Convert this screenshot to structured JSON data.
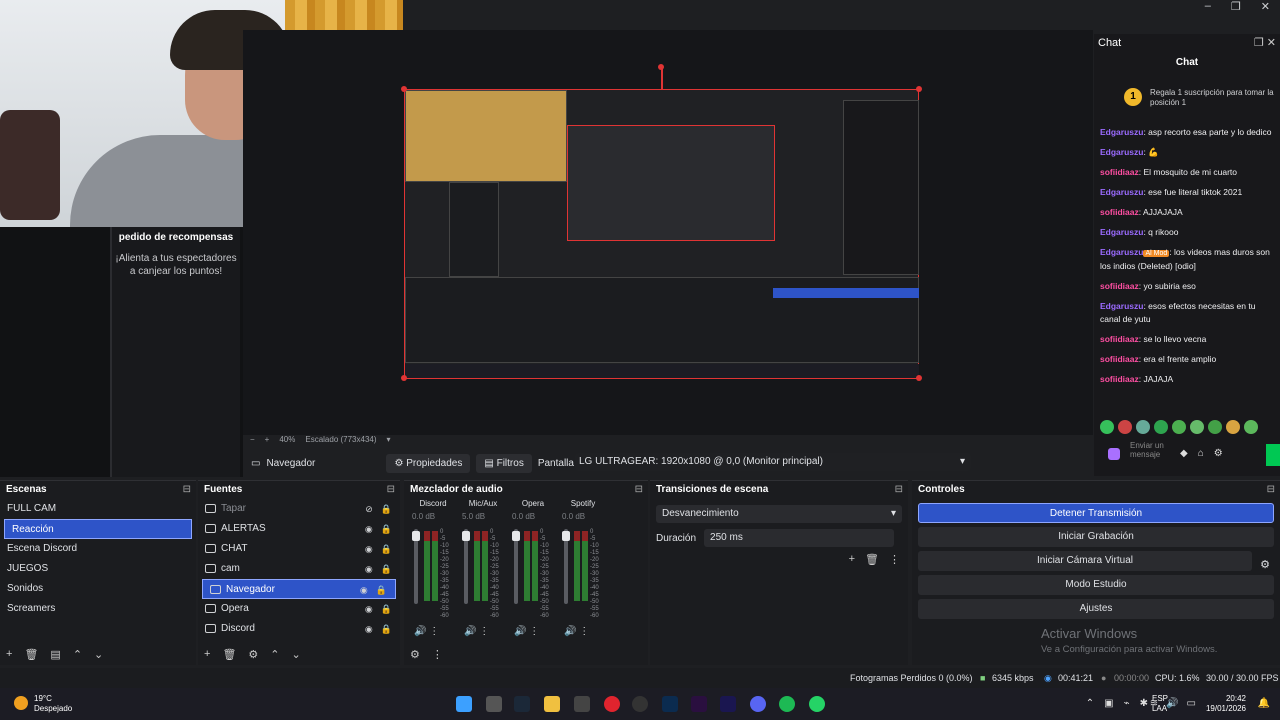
{
  "window": {
    "controls": [
      "–",
      "❐",
      "✕"
    ]
  },
  "rewards": {
    "title": "pedido de recompensas",
    "subtitle": "¡Alienta a tus espectadores a canjear los puntos!"
  },
  "preview": {
    "zoom": "40%",
    "scaling": "Escalado (773x434)"
  },
  "chat": {
    "dock_title": "Chat",
    "header": "Chat",
    "sub_badge": "1",
    "sub_text": "Regala 1 suscripción para tomar la posición 1",
    "messages": [
      {
        "user": "Edgaruszu",
        "text": ": asp recorto esa parte y lo dedico",
        "color": "u1"
      },
      {
        "user": "Edgaruszu",
        "text": ": 💪",
        "color": "u1"
      },
      {
        "user": "sofiidiaaz",
        "text": ": El mosquito de mi cuarto",
        "color": "u2"
      },
      {
        "user": "Edgaruszu",
        "text": ": ese fue literal tiktok 2021",
        "color": "u1"
      },
      {
        "user": "sofiidiaaz",
        "text": ": AJJAJAJA",
        "color": "u2"
      },
      {
        "user": "Edgaruszu",
        "text": ": q rikooo",
        "color": "u1"
      },
      {
        "user": "Edgaruszu",
        "text": ": los videos mas duros son los indios (Deleted) [odio]",
        "color": "u1",
        "badge": "Al Mod"
      },
      {
        "user": "sofiidiaaz",
        "text": ": yo subiria eso",
        "color": "u2"
      },
      {
        "user": "Edgaruszu",
        "text": ": esos efectos necesitas en tu canal de yutu",
        "color": "u1"
      },
      {
        "user": "sofiidiaaz",
        "text": ": se lo llevo vecna",
        "color": "u2"
      },
      {
        "user": "sofiidiaaz",
        "text": ": era el frente amplio",
        "color": "u2"
      },
      {
        "user": "sofiidiaaz",
        "text": ": JAJAJA",
        "color": "u2"
      }
    ],
    "input_placeholder": "Enviar un mensaje"
  },
  "toolbar": {
    "source_name": "Navegador",
    "properties": "Propiedades",
    "filters": "Filtros",
    "screen_label": "Pantalla",
    "monitor": "LG ULTRAGEAR: 1920x1080 @ 0,0 (Monitor principal)"
  },
  "scenes": {
    "title": "Escenas",
    "items": [
      "FULL CAM",
      "Reacción",
      "Escena Discord",
      "JUEGOS",
      "Sonidos",
      "Screamers"
    ],
    "selected": 1
  },
  "sources": {
    "title": "Fuentes",
    "items": [
      "Tapar",
      "ALERTAS",
      "CHAT",
      "cam",
      "Navegador",
      "Opera",
      "Discord"
    ],
    "selected": 4
  },
  "mixer": {
    "title": "Mezclador de audio",
    "channels": [
      {
        "name": "Discord",
        "db": "0.0 dB"
      },
      {
        "name": "Mic/Aux",
        "db": "5.0 dB"
      },
      {
        "name": "Opera",
        "db": "0.0 dB"
      },
      {
        "name": "Spotify",
        "db": "0.0 dB"
      }
    ],
    "scale": [
      "0",
      "-5",
      "-10",
      "-15",
      "-20",
      "-25",
      "-30",
      "-35",
      "-40",
      "-45",
      "-50",
      "-55",
      "-60"
    ]
  },
  "transitions": {
    "title": "Transiciones de escena",
    "selected": "Desvanecimiento",
    "duration_label": "Duración",
    "duration": "250 ms"
  },
  "controls": {
    "title": "Controles",
    "buttons": [
      "Detener Transmisión",
      "Iniciar Grabación",
      "Iniciar Cámara Virtual",
      "Modo Estudio",
      "Ajustes"
    ],
    "activate_title": "Activar Windows",
    "activate_sub": "Ve a Configuración para activar Windows."
  },
  "status": {
    "dropped": "Fotogramas Perdidos 0 (0.0%)",
    "bitrate": "6345 kbps",
    "live_time": "00:41:21",
    "rec_time": "00:00:00",
    "cpu": "CPU: 1.6%",
    "fps": "30.00 / 30.00 FPS"
  },
  "taskbar": {
    "temp": "19°C",
    "weather": "Despejado",
    "lang1": "ESP",
    "lang2": "LAA",
    "time": "20:42",
    "date": "19/01/2026"
  }
}
